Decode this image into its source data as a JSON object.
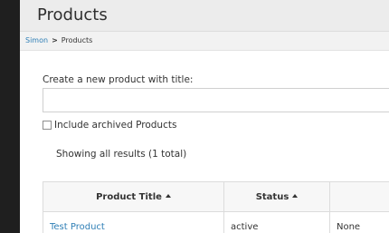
{
  "page": {
    "title": "Products"
  },
  "breadcrumb": {
    "items": [
      "Simon",
      "Products"
    ],
    "separator": ">"
  },
  "create": {
    "label": "Create a new product with title:",
    "value": "",
    "placeholder": ""
  },
  "filter": {
    "archived_label": "Include archived Products",
    "checked": false
  },
  "results": {
    "summary": "Showing all results (1 total)"
  },
  "table": {
    "columns": [
      {
        "label": "Product Title",
        "sort_icon": "sort-asc-icon"
      },
      {
        "label": "Status",
        "sort_icon": "sort-asc-icon"
      },
      {
        "label": ""
      }
    ],
    "rows": [
      {
        "title": "Test Product",
        "status": "active",
        "extra": "None"
      }
    ]
  },
  "colors": {
    "link": "#2f7fb6",
    "backdrop": "#1f1f1f",
    "header_bg": "#ececec"
  }
}
